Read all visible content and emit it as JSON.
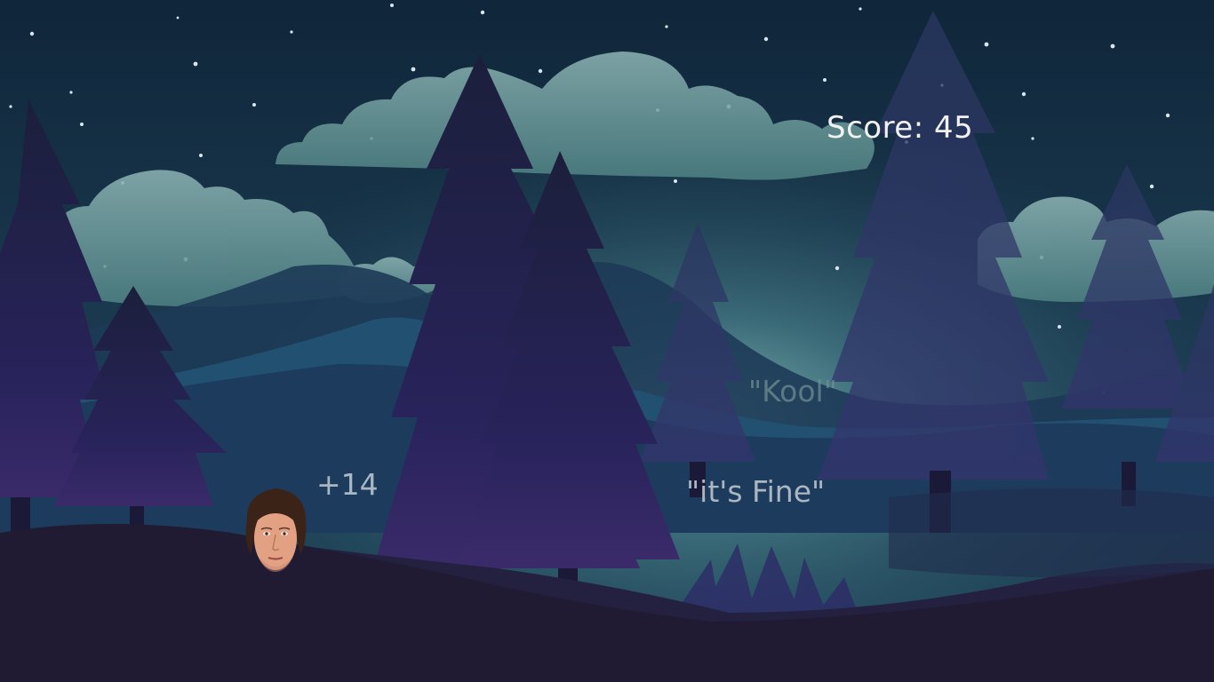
{
  "hud": {
    "score_label": "Score: ",
    "score_value": "45"
  },
  "popups": {
    "points": "+14",
    "kool": "\"Kool\"",
    "fine": "\"it's Fine\""
  },
  "colors": {
    "sky": "#17304a",
    "cloud": "#6fa3a0",
    "tree": "#1c1d3d",
    "ground": "#201b33",
    "text": "#f1f1f1"
  }
}
